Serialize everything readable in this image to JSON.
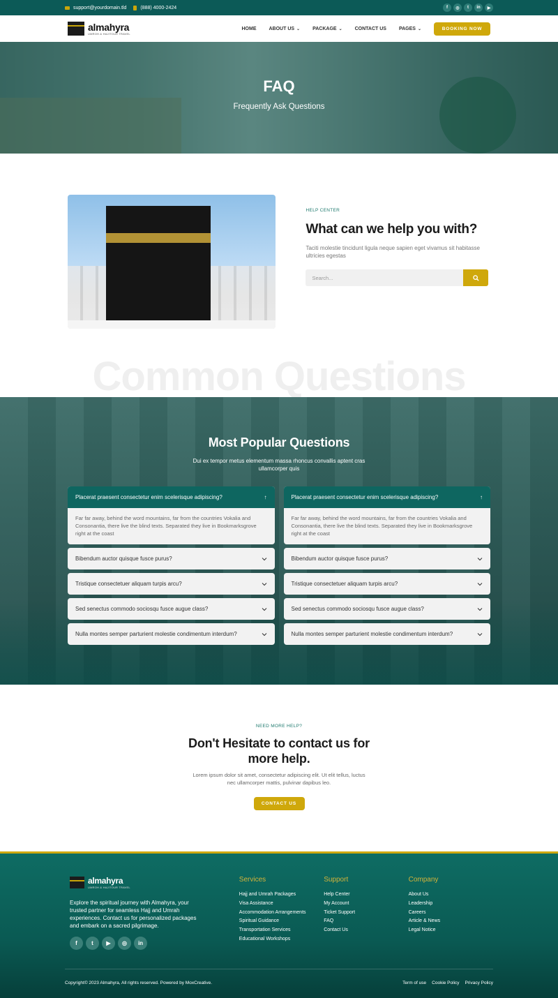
{
  "topbar": {
    "email": "support@yourdomain.tld",
    "phone": "(888) 4000-2424",
    "socials": [
      "facebook-icon",
      "instagram-icon",
      "twitter-icon",
      "linkedin-icon",
      "youtube-icon"
    ]
  },
  "nav": {
    "logo_name": "almahyra",
    "logo_tagline": "UMROH & HAJITOUR TRAVEL",
    "items": [
      {
        "label": "HOME",
        "dropdown": false
      },
      {
        "label": "ABOUT US",
        "dropdown": true
      },
      {
        "label": "PACKAGE",
        "dropdown": true
      },
      {
        "label": "CONTACT US",
        "dropdown": false
      },
      {
        "label": "PAGES",
        "dropdown": true
      }
    ],
    "booking_label": "BOOKING NOW"
  },
  "hero": {
    "title": "FAQ",
    "subtitle": "Frequently Ask Questions"
  },
  "help": {
    "eyebrow": "HELP CENTER",
    "title": "What can we help you with?",
    "description": "Taciti molestie tincidunt ligula neque sapien eget vivamus sit habitasse ultricies egestas",
    "search_placeholder": "Search..."
  },
  "watermark": "Common Questions",
  "faq": {
    "title": "Most Popular Questions",
    "subtitle": "Dui ex tempor metus elementum massa rhoncus convallis aptent cras ullamcorper quis",
    "columns": [
      {
        "open": {
          "question": "Placerat praesent consectetur enim scelerisque adipiscing?",
          "answer": "Far far away, behind the word mountains, far from the countries Vokalia and Consonantia, there live the blind texts. Separated they live in Bookmarksgrove right at the coast"
        },
        "closed": [
          "Bibendum auctor quisque fusce purus?",
          "Tristique consectetuer aliquam turpis arcu?",
          "Sed senectus commodo sociosqu fusce augue class?",
          "Nulla montes semper parturient molestie condimentum interdum?"
        ]
      },
      {
        "open": {
          "question": "Placerat praesent consectetur enim scelerisque adipiscing?",
          "answer": "Far far away, behind the word mountains, far from the countries Vokalia and Consonantia, there live the blind texts. Separated they live in Bookmarksgrove right at the coast"
        },
        "closed": [
          "Bibendum auctor quisque fusce purus?",
          "Tristique consectetuer aliquam turpis arcu?",
          "Sed senectus commodo sociosqu fusce augue class?",
          "Nulla montes semper parturient molestie condimentum interdum?"
        ]
      }
    ]
  },
  "contact": {
    "eyebrow": "NEED MORE HELP?",
    "title": "Don't Hesitate to contact us for more help.",
    "description": "Lorem ipsum dolor sit amet, consectetur adipiscing elit. Ut elit tellus, luctus nec ullamcorper mattis, pulvinar dapibus leo.",
    "button_label": "CONTACT US"
  },
  "footer": {
    "logo_name": "almahyra",
    "logo_tagline": "UMROH & HAJITOUR TRAVEL",
    "about": "Explore the spiritual journey with Almahyra, your trusted partner for seamless Hajj and Umrah experiences. Contact us for personalized packages and embark on a sacred pilgrimage.",
    "socials": [
      "facebook-icon",
      "twitter-icon",
      "youtube-icon",
      "instagram-icon",
      "linkedin-icon"
    ],
    "columns": [
      {
        "title": "Services",
        "links": [
          "Hajj and Umrah Packages",
          "Visa Assistance",
          "Accommodation Arrangements",
          "Spiritual Guidance",
          "Transportation Services",
          "Educational Workshops"
        ]
      },
      {
        "title": "Support",
        "links": [
          "Help Center",
          "My Account",
          "Ticket Support",
          "FAQ",
          "Contact Us"
        ]
      },
      {
        "title": "Company",
        "links": [
          "About Us",
          "Leadership",
          "Careers",
          "Article & News",
          "Legal Notice"
        ]
      }
    ],
    "copyright": "Copyright© 2023 Almahyra, All rights reserved. Powered by MoxCreative.",
    "legal_links": [
      "Term of use",
      "Cookie Policy",
      "Privacy Policy"
    ]
  },
  "colors": {
    "primary": "#0c5a57",
    "accent": "#cfa80b"
  }
}
